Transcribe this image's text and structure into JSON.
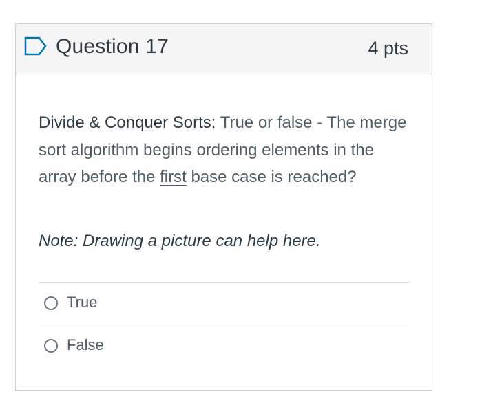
{
  "header": {
    "title": "Question 17",
    "points": "4 pts",
    "flag_icon": "flag-outline-icon"
  },
  "question": {
    "lead": "Divide & Conquer Sorts:",
    "stem_before": " True or false - The merge sort algorithm begins ordering elements in the array before the ",
    "underlined": "first",
    "stem_after": " base case is reached?",
    "note": "Note: Drawing a picture can help here."
  },
  "answers": [
    {
      "label": "True",
      "selected": false
    },
    {
      "label": "False",
      "selected": false
    }
  ],
  "colors": {
    "text": "#2d3b45",
    "muted_text": "#4f5d67",
    "border": "#c7cdd1",
    "header_bg": "#f5f5f5",
    "flag": "#0374b5"
  }
}
